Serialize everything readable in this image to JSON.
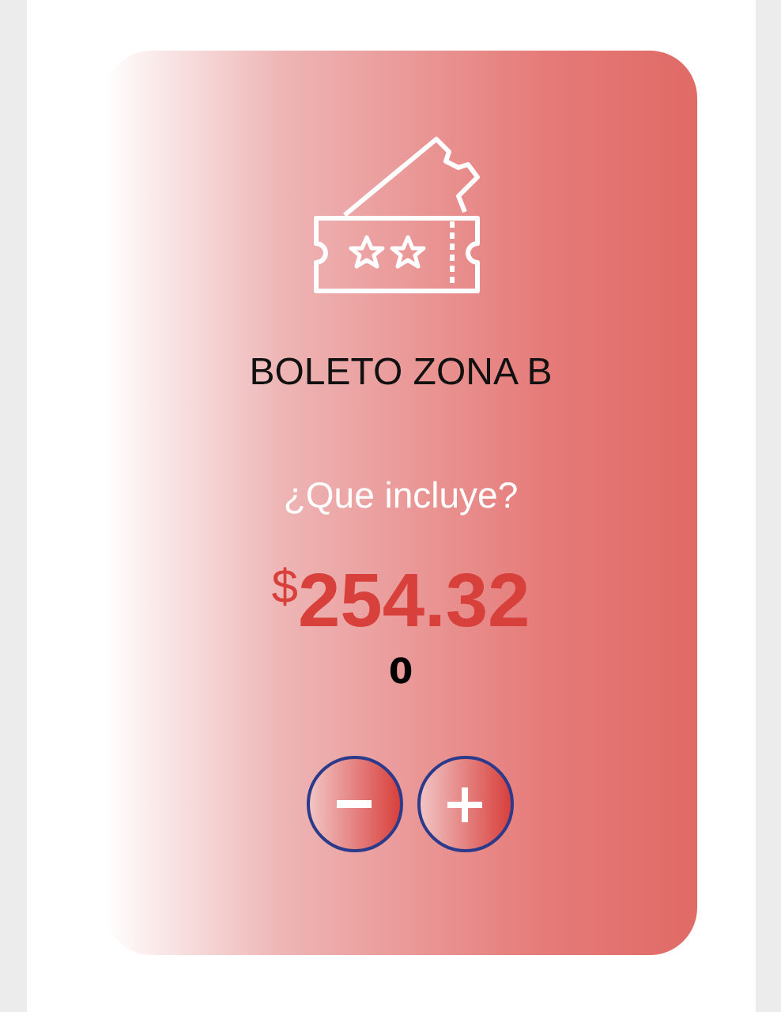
{
  "card": {
    "title": "BOLETO ZONA B",
    "subtitle": "¿Que incluye?",
    "currency": "$",
    "price": "254.32",
    "quantity": "0"
  }
}
